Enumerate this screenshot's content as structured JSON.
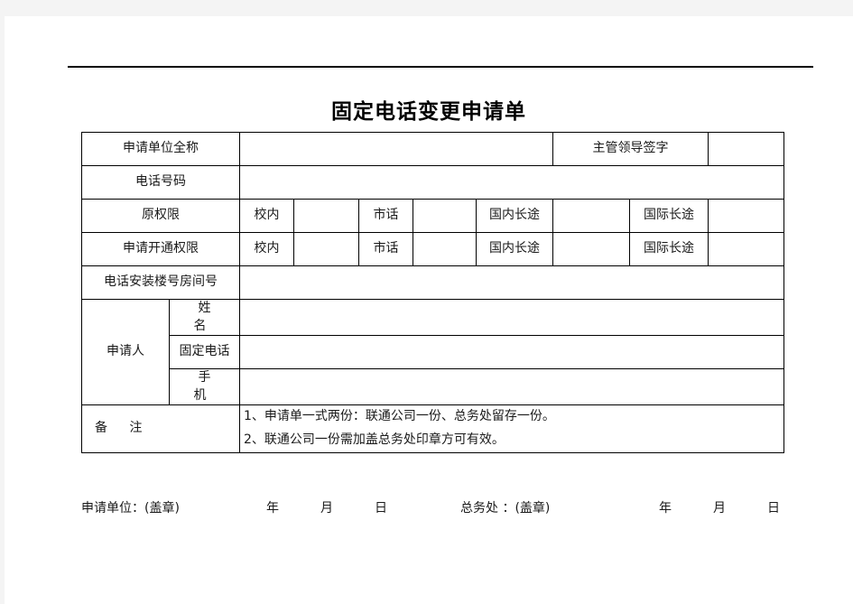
{
  "document": {
    "title": "固定电话变更申请单"
  },
  "table": {
    "row_applicant_unit": {
      "label": "申请单位全称",
      "value": "",
      "approver_label": "主管领导签字",
      "approver_value": ""
    },
    "row_phone_number": {
      "label": "电话号码",
      "value": ""
    },
    "row_original_permission": {
      "label": "原权限",
      "items": [
        {
          "label": "校内",
          "value": ""
        },
        {
          "label": "市话",
          "value": ""
        },
        {
          "label": "国内长途",
          "value": ""
        },
        {
          "label": "国际长途",
          "value": ""
        }
      ]
    },
    "row_requested_permission": {
      "label": "申请开通权限",
      "items": [
        {
          "label": "校内",
          "value": ""
        },
        {
          "label": "市话",
          "value": ""
        },
        {
          "label": "国内长途",
          "value": ""
        },
        {
          "label": "国际长途",
          "value": ""
        }
      ]
    },
    "row_install_location": {
      "label": "电话安装楼号房间号",
      "value": ""
    },
    "row_applicant": {
      "label": "申请人",
      "fields": [
        {
          "label": "姓  名",
          "value": ""
        },
        {
          "label": "固定电话",
          "value": ""
        },
        {
          "label": "手  机",
          "value": ""
        }
      ]
    },
    "row_remarks": {
      "label": "备  注",
      "lines": [
        "1、申请单一式两份：联通公司一份、总务处留存一份。",
        "2、联通公司一份需加盖总务处印章方可有效。"
      ]
    }
  },
  "footer": {
    "applicant_seal": "申请单位：(盖章)",
    "year_1": "年",
    "month_1": "月",
    "day_1": "日",
    "office_seal": "总务处 ：(盖章)",
    "year_2": "年",
    "month_2": "月",
    "day_2": "日"
  }
}
